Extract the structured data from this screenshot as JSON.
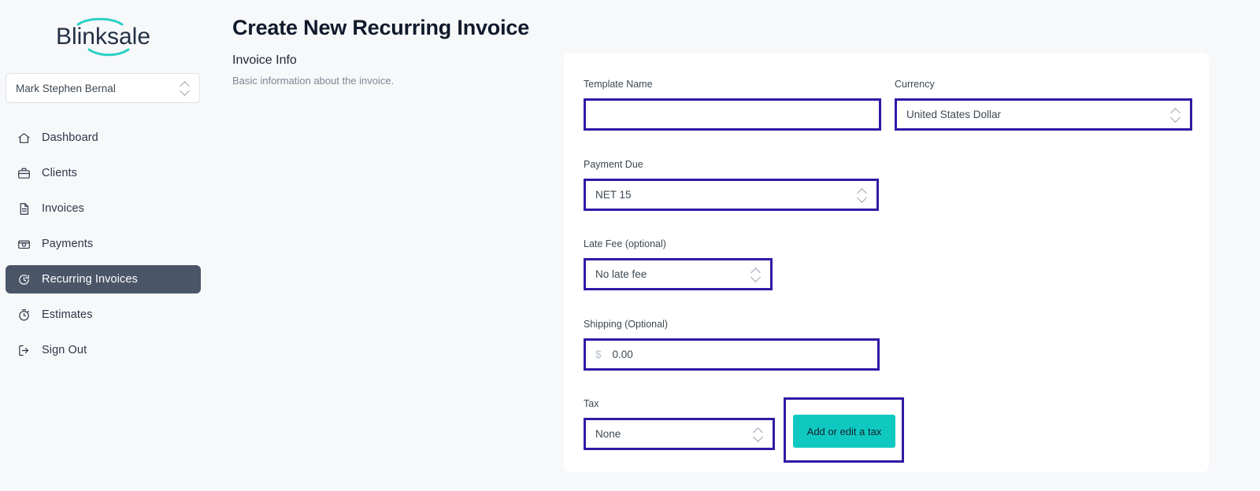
{
  "brand": {
    "logo_text": "Blinksale",
    "logo_color": "#233044",
    "accent_color": "#2ad1c4"
  },
  "sidebar": {
    "account": {
      "name": "Mark Stephen Bernal",
      "icon": "chevron-updown-icon"
    },
    "items": [
      {
        "label": "Dashboard",
        "icon": "home-icon",
        "active": false
      },
      {
        "label": "Clients",
        "icon": "briefcase-icon",
        "active": false
      },
      {
        "label": "Invoices",
        "icon": "document-icon",
        "active": false
      },
      {
        "label": "Payments",
        "icon": "card-icon",
        "active": false
      },
      {
        "label": "Recurring Invoices",
        "icon": "refresh-icon",
        "active": true
      },
      {
        "label": "Estimates",
        "icon": "stopwatch-icon",
        "active": false
      },
      {
        "label": "Sign Out",
        "icon": "sign-out-icon",
        "active": false
      }
    ],
    "active_bg": "#4a5568"
  },
  "header": {
    "title": "Create New Recurring Invoice"
  },
  "section": {
    "title": "Invoice Info",
    "description": "Basic information about the invoice."
  },
  "form": {
    "template_name": {
      "label": "Template Name",
      "value": "",
      "placeholder": ""
    },
    "currency": {
      "label": "Currency",
      "value": "United States Dollar",
      "icon": "chevron-updown-icon"
    },
    "payment_due": {
      "label": "Payment Due",
      "value": "NET 15",
      "icon": "chevron-updown-icon"
    },
    "late_fee": {
      "label": "Late Fee (optional)",
      "value": "No late fee",
      "icon": "chevron-updown-icon"
    },
    "shipping": {
      "label": "Shipping (Optional)",
      "currency_symbol": "$",
      "value": "0.00"
    },
    "tax": {
      "label": "Tax",
      "value": "None",
      "icon": "chevron-updown-icon",
      "button_label": "Add or edit a tax",
      "button_color": "#0fc9c0"
    }
  },
  "highlight": {
    "color": "#2e1ba6"
  }
}
